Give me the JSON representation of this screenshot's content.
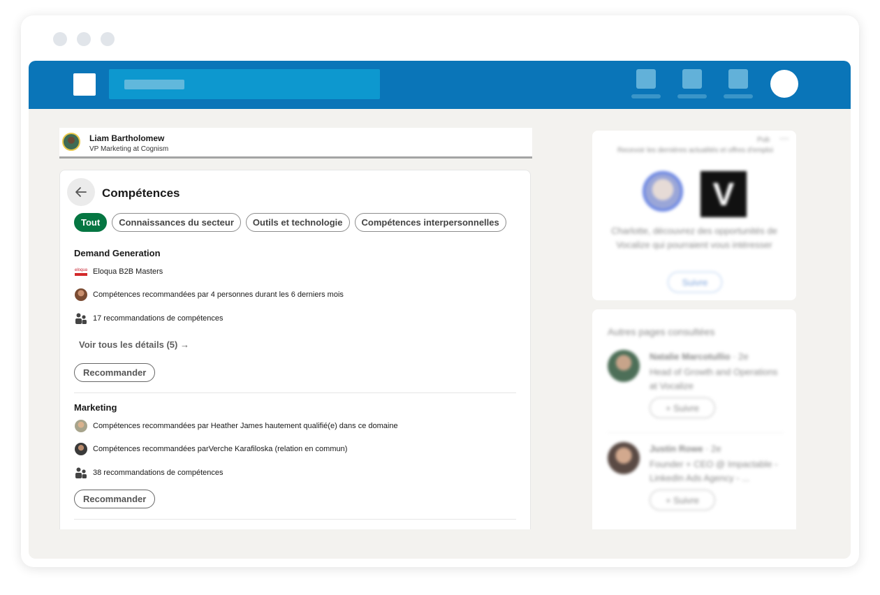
{
  "profile": {
    "name": "Liam Bartholomew",
    "role": "VP Marketing at Cognism"
  },
  "section": {
    "title": "Compétences",
    "filters": [
      {
        "label": "Tout",
        "active": true
      },
      {
        "label": "Connaissances du secteur",
        "active": false
      },
      {
        "label": "Outils et technologie",
        "active": false
      },
      {
        "label": "Compétences interpersonnelles",
        "active": false
      }
    ]
  },
  "skills": [
    {
      "title": "Demand Generation",
      "rows": [
        {
          "icon": "eloqua-logo-icon",
          "text": "Eloqua B2B Masters"
        },
        {
          "icon": "avatar-icon",
          "text": "Compétences recommandées par 4 personnes durant les 6 derniers mois"
        },
        {
          "icon": "people-icon",
          "text": "17 recommandations de compétences"
        }
      ],
      "details_link": "Voir tous les détails (5) →",
      "button": "Recommander"
    },
    {
      "title": "Marketing",
      "rows": [
        {
          "icon": "avatar-icon",
          "text": "Compétences recommandées par Heather James hautement qualifié(e) dans ce domaine"
        },
        {
          "icon": "avatar-icon",
          "text": "Compétences recommandées parVerche Karafiloska (relation en commun)"
        },
        {
          "icon": "people-icon",
          "text": "38 recommandations de compétences"
        }
      ],
      "button": "Recommander"
    }
  ],
  "eloqua_logo_text": "eloqua",
  "sidebar": {
    "ad": {
      "label": "Pub",
      "subtitle": "Recevoir les dernières actualités et offres d'emploi",
      "text": "Charlotte, découvrez des opportunités de Vocalize qui pourraient vous intéresser",
      "button": "Suivre",
      "logo_letter": "V"
    },
    "others": {
      "title": "Autres pages consultées",
      "people": [
        {
          "name": "Natalie Marcotullio",
          "degree": "· 2e",
          "headline": "Head of Growth and Operations at Vocalize",
          "button": "+ Suivre"
        },
        {
          "name": "Justin Rowe",
          "degree": "· 2e",
          "headline": "Founder + CEO @ Impactable - LinkedIn Ads Agency - ...",
          "button": "+ Suivre"
        }
      ]
    }
  },
  "colors": {
    "brand_blue": "#0a75b8",
    "active_chip": "#057642",
    "page_bg": "#f3f2ef"
  }
}
